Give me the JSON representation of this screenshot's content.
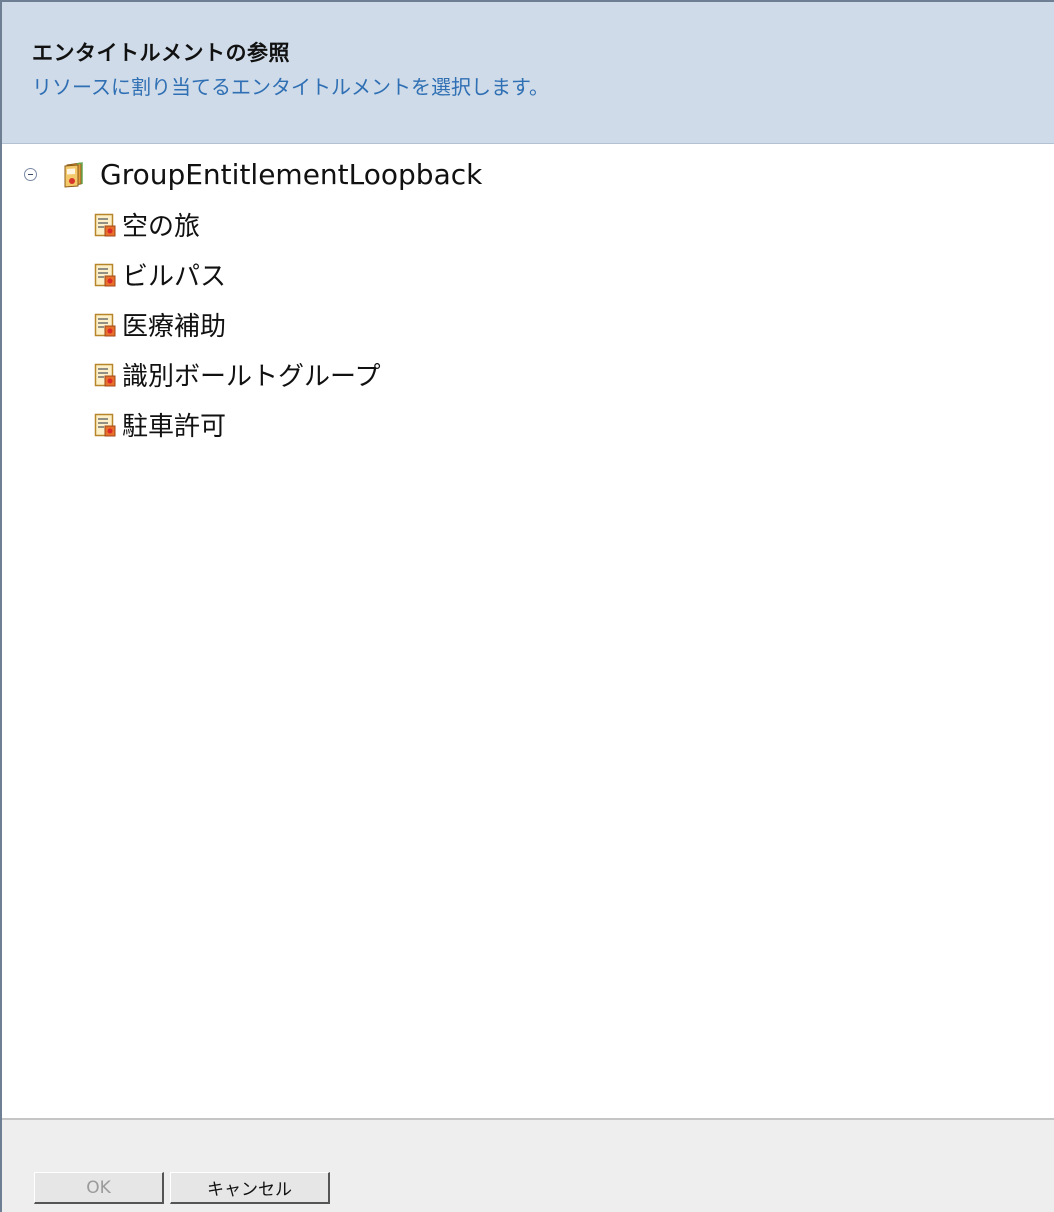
{
  "header": {
    "title": "エンタイトルメントの参照",
    "subtitle": "リソースに割り当てるエンタイトルメントを選択します。"
  },
  "tree": {
    "root": {
      "label": "GroupEntitlementLoopback",
      "icon": "entitlement-folder-icon",
      "expanded": true
    },
    "items": [
      {
        "label": "空の旅",
        "icon": "entitlement-icon"
      },
      {
        "label": "ビルパス",
        "icon": "entitlement-icon"
      },
      {
        "label": "医療補助",
        "icon": "entitlement-icon"
      },
      {
        "label": "識別ボールトグループ",
        "icon": "entitlement-icon"
      },
      {
        "label": "駐車許可",
        "icon": "entitlement-icon"
      }
    ]
  },
  "footer": {
    "ok_label": "OK",
    "ok_enabled": false,
    "cancel_label": "キャンセル"
  },
  "colors": {
    "header_background": "#cfdbe8",
    "subtitle": "#2f6fb4",
    "footer_background": "#eeeeee"
  }
}
